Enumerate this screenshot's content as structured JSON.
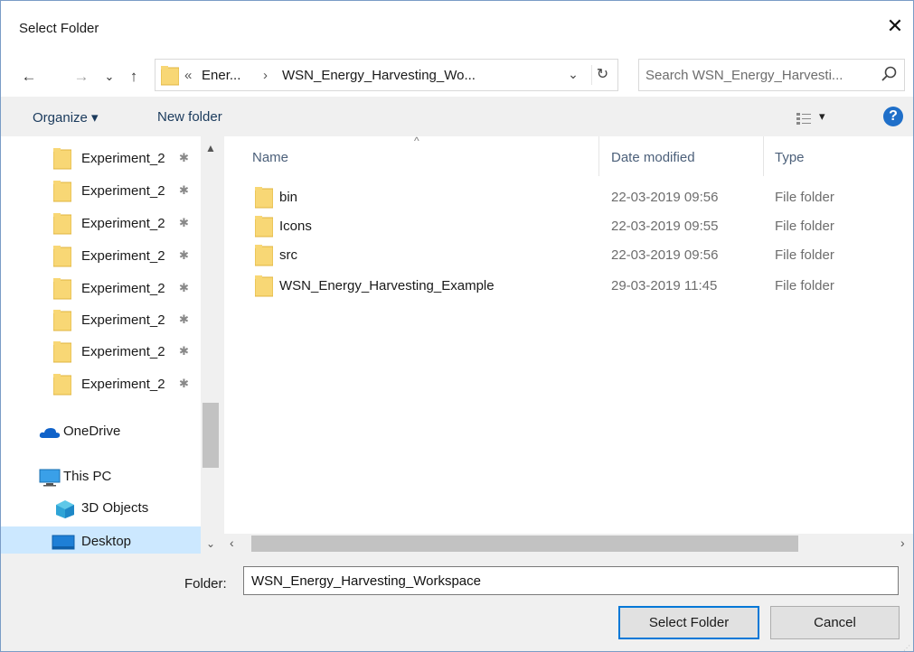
{
  "window": {
    "title": "Select Folder",
    "close_glyph": "✕"
  },
  "nav_buttons": {
    "back": "←",
    "forward": "→",
    "recent": "⌄",
    "up": "↑"
  },
  "address": {
    "overflow": "«",
    "crumb1": "Ener...",
    "sep": "›",
    "crumb2": "WSN_Energy_Harvesting_Wo...",
    "dropdown": "⌄",
    "refresh": "↻"
  },
  "search": {
    "placeholder": "Search WSN_Energy_Harvesti..."
  },
  "toolbar": {
    "organize": "Organize ▾",
    "new_folder": "New folder",
    "view_caret": "▾",
    "help": "?"
  },
  "nav_pane": {
    "quick_access": [
      {
        "label": "Experiment_2"
      },
      {
        "label": "Experiment_2"
      },
      {
        "label": "Experiment_2"
      },
      {
        "label": "Experiment_2"
      },
      {
        "label": "Experiment_2"
      },
      {
        "label": "Experiment_2"
      },
      {
        "label": "Experiment_2"
      },
      {
        "label": "Experiment_2"
      }
    ],
    "pin_glyph": "✱",
    "onedrive": "OneDrive",
    "this_pc": "This PC",
    "objects_3d": "3D Objects",
    "desktop": "Desktop",
    "scroll_up": "▲",
    "scroll_down": "⌄"
  },
  "file_list": {
    "columns": {
      "name": "Name",
      "date": "Date modified",
      "type": "Type"
    },
    "sort_caret": "^",
    "rows": [
      {
        "name": "bin",
        "date": "22-03-2019 09:56",
        "type": "File folder"
      },
      {
        "name": "Icons",
        "date": "22-03-2019 09:55",
        "type": "File folder"
      },
      {
        "name": "src",
        "date": "22-03-2019 09:56",
        "type": "File folder"
      },
      {
        "name": "WSN_Energy_Harvesting_Example",
        "date": "29-03-2019 11:45",
        "type": "File folder"
      }
    ]
  },
  "hscroll": {
    "left": "‹",
    "right": "›"
  },
  "bottom": {
    "folder_label": "Folder:",
    "folder_value": "WSN_Energy_Harvesting_Workspace",
    "select_button": "Select Folder",
    "cancel_button": "Cancel"
  },
  "colors": {
    "accent": "#0078d7",
    "selection": "#cce8ff",
    "folder": "#f8d775",
    "help": "#1f6fc9"
  }
}
